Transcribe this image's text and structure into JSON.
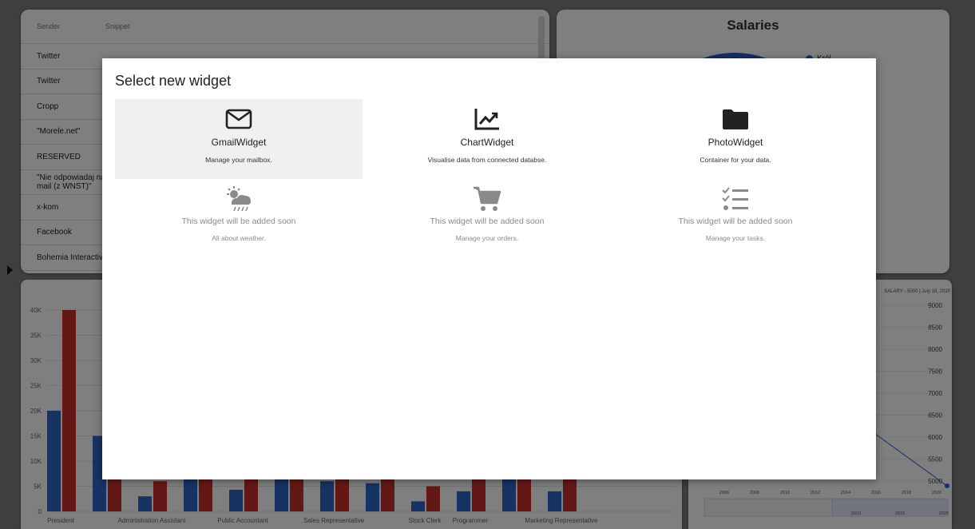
{
  "inbox": {
    "headers": [
      "Sender",
      "Snippet"
    ],
    "rows": [
      "Twitter",
      "Twitter",
      "Cropp",
      "\"Morele.net\"",
      "RESERVED",
      "\"Nie odpowiadaj na ten mail (z WNST)\"",
      "x-kom",
      "Facebook",
      "Bohemia Interactive"
    ]
  },
  "salaries": {
    "title": "Salaries",
    "legend": [
      "Król"
    ],
    "colors": [
      "#2b5fd1",
      "#d48a1c"
    ]
  },
  "chart_data": [
    {
      "type": "bar",
      "categories": [
        "President",
        "",
        "Administration Assistant",
        "",
        "Public Accountant",
        "",
        "Sales Representative",
        "",
        "Stock Clerk",
        "Programmer",
        "",
        "Marketing Representative"
      ],
      "series": [
        {
          "values": [
            20000,
            15000,
            3000,
            7000,
            4300,
            7000,
            6000,
            5600,
            2000,
            4000,
            7000,
            4000
          ]
        },
        {
          "values": [
            40000,
            7000,
            6000,
            7000,
            7000,
            7000,
            7000,
            7000,
            5000,
            7000,
            7000,
            7000
          ]
        }
      ],
      "ylim": [
        0,
        40000
      ],
      "y_ticks": [
        "0",
        "5K",
        "10K",
        "15K",
        "20K",
        "25K",
        "30K",
        "35K",
        "40K"
      ],
      "colors": [
        "#2e66c9",
        "#c8302c"
      ]
    },
    {
      "type": "line",
      "legend": "SALARY - 5000 | July 18, 2020",
      "y_ticks": [
        "5000",
        "5500",
        "6000",
        "6500",
        "7000",
        "7500",
        "8000",
        "8500",
        "9000"
      ],
      "x_ticks": [
        "2006",
        "2008",
        "2010",
        "2012",
        "2014",
        "2016",
        "2018",
        "2020"
      ],
      "nav_ticks": [
        "2010",
        "2015",
        "2020"
      ],
      "ylim": [
        4900,
        9200
      ]
    }
  ],
  "modal": {
    "title": "Select new widget",
    "widgets": [
      {
        "name": "GmailWidget",
        "desc": "Manage your mailbox.",
        "icon": "mail-icon",
        "enabled": true
      },
      {
        "name": "ChartWidget",
        "desc": "Visualise data from connected databse.",
        "icon": "chart-icon",
        "enabled": true
      },
      {
        "name": "PhotoWidget",
        "desc": "Container for your data.",
        "icon": "folder-icon",
        "enabled": true
      },
      {
        "name": "This widget will be added soon",
        "desc": "All about weather.",
        "icon": "weather-icon",
        "enabled": false
      },
      {
        "name": "This widget will be added soon",
        "desc": "Manage your orders.",
        "icon": "cart-icon",
        "enabled": false
      },
      {
        "name": "This widget will be added soon",
        "desc": "Manage your tasks.",
        "icon": "checklist-icon",
        "enabled": false
      }
    ]
  }
}
